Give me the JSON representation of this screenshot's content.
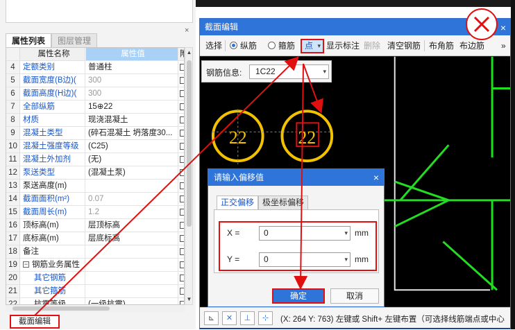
{
  "property_panel": {
    "tabs": [
      "属性列表",
      "图层管理"
    ],
    "close_glyph": "×",
    "header": {
      "name": "属性名称",
      "value": "属性值",
      "extra": "附"
    },
    "rows": [
      {
        "num": "4",
        "name": "定额类别",
        "value": "普通柱",
        "name_style": "blue",
        "value_style": "normal"
      },
      {
        "num": "5",
        "name": "截面宽度(B边)(",
        "value": "300",
        "name_style": "blue",
        "value_style": "grey"
      },
      {
        "num": "6",
        "name": "截面高度(H边)(",
        "value": "300",
        "name_style": "blue",
        "value_style": "grey"
      },
      {
        "num": "7",
        "name": "全部纵筋",
        "value": "15⊕22",
        "name_style": "blue",
        "value_style": "normal"
      },
      {
        "num": "8",
        "name": "材质",
        "value": "现浇混凝土",
        "name_style": "blue",
        "value_style": "normal"
      },
      {
        "num": "9",
        "name": "混凝土类型",
        "value": "(碎石混凝土 坍落度30...",
        "name_style": "blue",
        "value_style": "normal"
      },
      {
        "num": "10",
        "name": "混凝土强度等级",
        "value": "(C25)",
        "name_style": "blue",
        "value_style": "normal"
      },
      {
        "num": "11",
        "name": "混凝土外加剂",
        "value": "(无)",
        "name_style": "blue",
        "value_style": "normal"
      },
      {
        "num": "12",
        "name": "泵送类型",
        "value": "(混凝土泵)",
        "name_style": "blue",
        "value_style": "normal"
      },
      {
        "num": "13",
        "name": "泵送高度(m)",
        "value": "",
        "name_style": "normal",
        "value_style": "normal"
      },
      {
        "num": "14",
        "name": "截面面积(m²)",
        "value": "0.07",
        "name_style": "blue",
        "value_style": "grey"
      },
      {
        "num": "15",
        "name": "截面周长(m)",
        "value": "1.2",
        "name_style": "blue",
        "value_style": "grey"
      },
      {
        "num": "16",
        "name": "顶标高(m)",
        "value": "层顶标高",
        "name_style": "normal",
        "value_style": "normal"
      },
      {
        "num": "17",
        "name": "底标高(m)",
        "value": "层底标高",
        "name_style": "normal",
        "value_style": "normal"
      },
      {
        "num": "18",
        "name": "备注",
        "value": "",
        "name_style": "normal",
        "value_style": "normal"
      },
      {
        "num": "19",
        "name": "钢筋业务属性",
        "value": "",
        "name_style": "normal",
        "value_style": "normal",
        "group": true,
        "expander": "−"
      },
      {
        "num": "20",
        "name": "其它钢筋",
        "value": "",
        "name_style": "blue",
        "value_style": "normal",
        "child": true
      },
      {
        "num": "21",
        "name": "其它箍筋",
        "value": "",
        "name_style": "blue",
        "value_style": "normal",
        "child": true
      },
      {
        "num": "22",
        "name": "抗震等级",
        "value": "(一级抗震)",
        "name_style": "normal",
        "value_style": "normal",
        "child": true
      }
    ],
    "bottom_tab": "截面编辑"
  },
  "section_window": {
    "title": "截面编辑",
    "close_glyph": "×",
    "toolbar": {
      "select": "选择",
      "longitudinal": "纵筋",
      "stirrup": "箍筋",
      "point": "点",
      "show_annotation": "显示标注",
      "delete": "删除",
      "clear_rebar": "清空钢筋",
      "corner_rebar": "布角筋",
      "edge_rebar": "布边筋",
      "more": "»"
    },
    "rebar_info_label": "钢筋信息:",
    "rebar_info_value": "1C22",
    "rebar_labels": [
      "22",
      "22"
    ],
    "status": "(X: 264 Y: 763)  左键或 Shift+ 左键布置（可选择线筋端点或中心"
  },
  "offset_dialog": {
    "title": "请输入偏移值",
    "close_glyph": "×",
    "tabs": [
      "正交偏移",
      "极坐标偏移"
    ],
    "x_label": "X =",
    "x_value": "0",
    "y_label": "Y =",
    "y_value": "0",
    "unit": "mm",
    "ok": "确定",
    "cancel": "取消"
  },
  "colors": {
    "accent": "#2f74d8",
    "highlight_red": "#e01010",
    "canvas_bg": "#000000",
    "rebar_circle": "#f2c200",
    "rebar_text": "#f2c200",
    "stirrup_green": "#22dd22"
  }
}
